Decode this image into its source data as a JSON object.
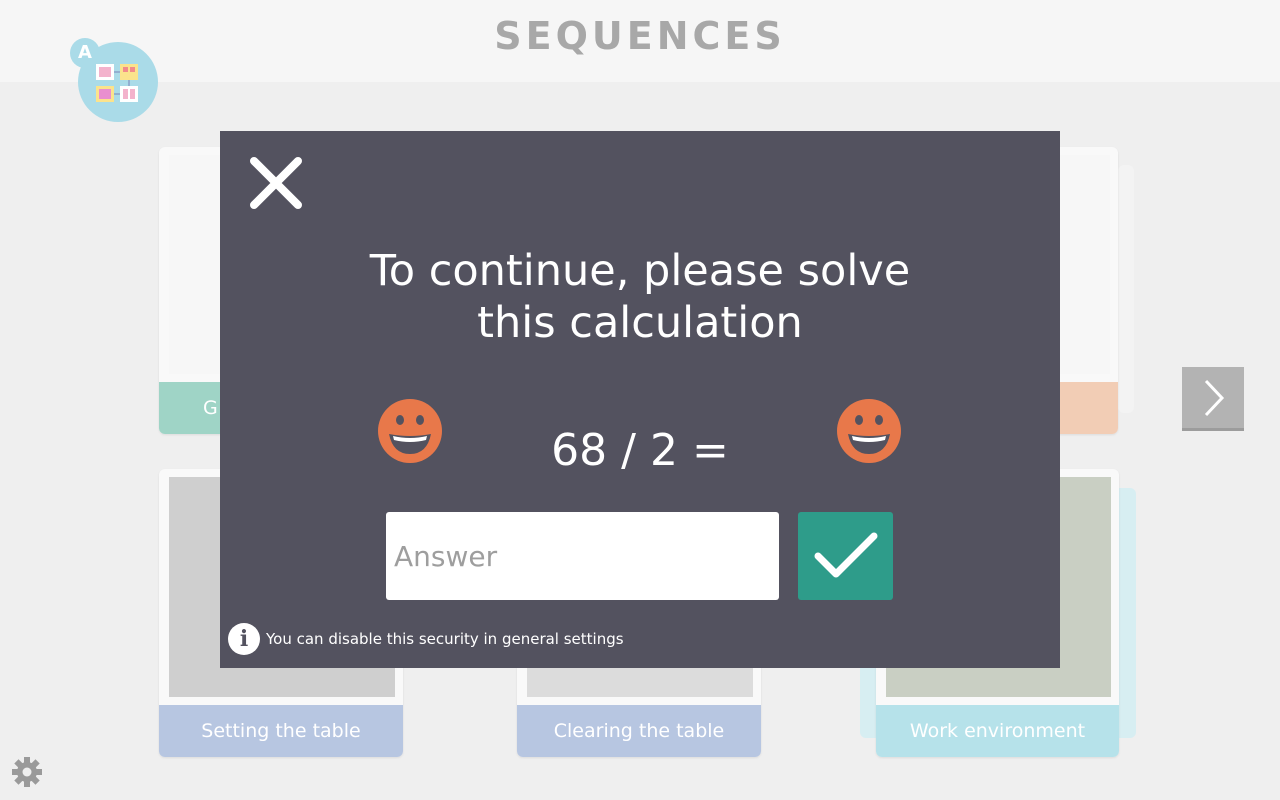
{
  "header": {
    "title": "SEQUENCES",
    "logo_letter": "A"
  },
  "cards": {
    "top_left_label_fragment": "G",
    "bottom": [
      {
        "label": "Setting the table"
      },
      {
        "label": "Clearing the table"
      },
      {
        "label": "Work environment"
      }
    ]
  },
  "modal": {
    "title_line1": "To continue, please solve",
    "title_line2": "this calculation",
    "equation": "68 / 2 =",
    "answer_placeholder": "Answer",
    "info_text": "You can disable this security in general settings",
    "info_glyph": "i"
  },
  "icons": {
    "close": "close-icon",
    "smiley": "smiley-icon",
    "confirm": "checkmark-icon",
    "next": "chevron-right-icon",
    "settings": "gear-icon",
    "info": "info-icon"
  },
  "colors": {
    "modal_bg": "#53525f",
    "confirm_green": "#2e9c8a",
    "smiley_orange": "#e8784a",
    "label_blue": "#b7c6e1",
    "label_cyan": "#b6e2ea",
    "label_teal": "#9fd4c6",
    "label_peach": "#f2cdb5"
  }
}
